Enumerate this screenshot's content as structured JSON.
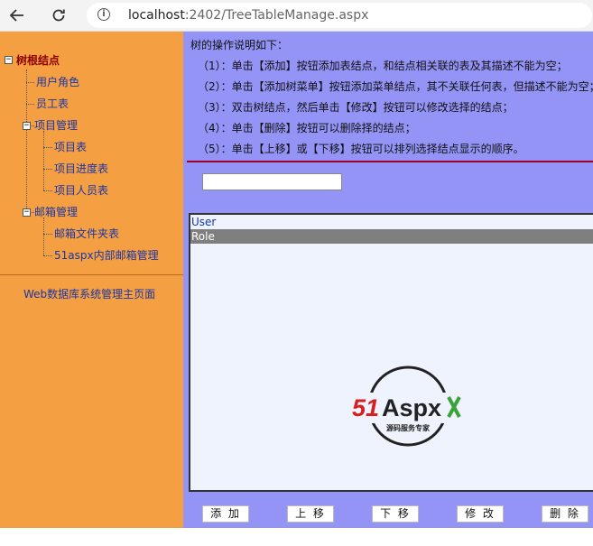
{
  "browser": {
    "url_host": "localhost",
    "url_rest": ":2402/TreeTableManage.aspx"
  },
  "tree": {
    "root": "树根结点",
    "items": {
      "user_role": "用户角色",
      "employee": "员工表",
      "project_mgmt": "项目管理",
      "project_table": "项目表",
      "project_progress": "项目进度表",
      "project_staff": "项目人员表",
      "mail_mgmt": "邮箱管理",
      "mail_folder": "邮箱文件夹表",
      "internal_mail": "51aspx内部邮箱管理"
    },
    "home_link": "Web数据库系统管理主页面"
  },
  "instructions": {
    "title": "树的操作说明如下：",
    "lines": [
      "（1）：单击【添加】按钮添加表结点，和结点相关联的表及其描述不能为空；",
      "（2）：单击【添加树菜单】按钮添加菜单结点，其不关联任何表，但描述不能为空；",
      "（3）：双击树结点，然后单击【修改】按钮可以修改选择的结点；",
      "（4）：单击【删除】按钮可以删除择的结点；",
      "（5）：单击【上移】或【下移】按钮可以排列选择结点显示的顺序。"
    ]
  },
  "form": {
    "name_value": ""
  },
  "list": {
    "items": [
      "User",
      "Role"
    ],
    "selected": "Role"
  },
  "logo": {
    "brand": "51Aspx",
    "tagline": "源码服务专家"
  },
  "buttons": {
    "add": "添 加",
    "up": "上 移",
    "down": "下 移",
    "edit": "修 改",
    "delete": "删 除"
  },
  "colors": {
    "left_panel": "#f39f42",
    "right_panel": "#9494f7",
    "listbox_bg": "#eef3fd",
    "selected_row": "#7f7f7f",
    "separator_red": "#a1002b",
    "link_blue": "#1a35a8",
    "root_red": "#8b0000"
  }
}
